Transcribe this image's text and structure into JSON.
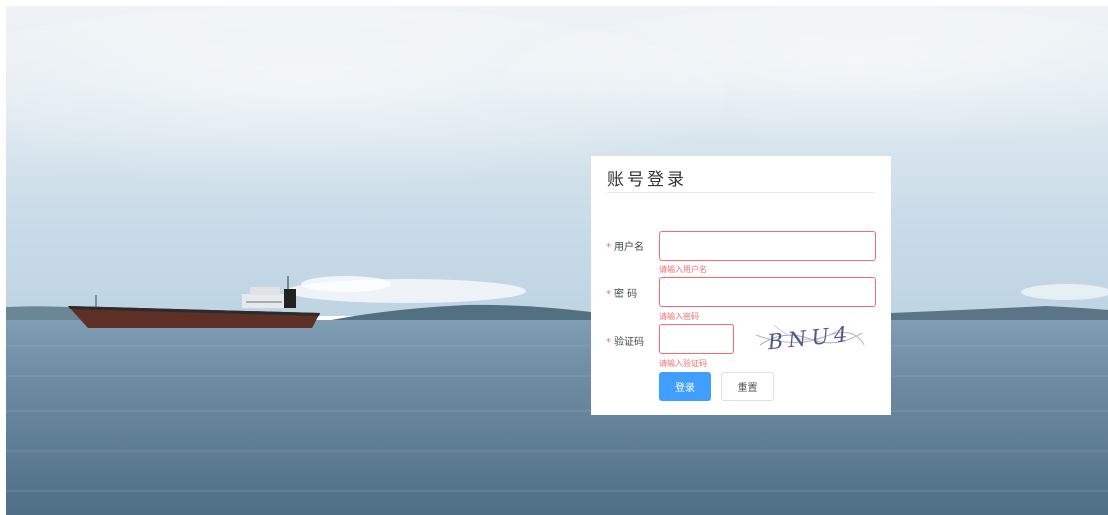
{
  "login": {
    "title": "账号登录",
    "username": {
      "label": "用户名",
      "required_mark": "*",
      "value": "",
      "error": "请输入用户名"
    },
    "password": {
      "label": "密 码",
      "required_mark": "*",
      "value": "",
      "error": "请输入密码"
    },
    "captcha": {
      "label": "验证码",
      "required_mark": "*",
      "value": "",
      "error": "请输入验证码",
      "image_text": "BNU4"
    },
    "submit_label": "登录",
    "reset_label": "重置"
  },
  "colors": {
    "primary": "#409eff",
    "error": "#f56c6c",
    "sky": "#cfe0ec",
    "sea": "#5a7f99"
  },
  "background": {
    "subject": "cargo ship on calm sea"
  }
}
